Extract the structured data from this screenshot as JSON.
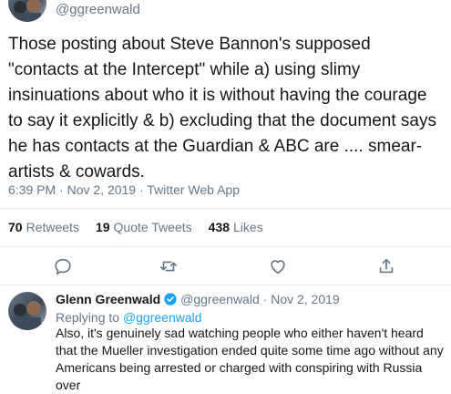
{
  "tweet": {
    "handle": "@ggreenwald",
    "text": "Those posting about Steve Bannon's supposed \"contacts at the Intercept\" while a) using slimy insinuations about who it is without having the courage to say it explicitly & b) excluding that the document says he has contacts at the Guardian & ABC are .... smear-artists & cowards.",
    "time": "6:39 PM",
    "separator": " · ",
    "date": "Nov 2, 2019",
    "app": "Twitter Web App",
    "retweets_count": "70",
    "retweets_label": "Retweets",
    "quote_count": "19",
    "quote_label": "Quote Tweets",
    "likes_count": "438",
    "likes_label": "Likes"
  },
  "actions": {
    "icons": [
      "reply-icon",
      "retweet-icon",
      "like-icon",
      "share-icon"
    ]
  },
  "reply": {
    "name": "Glenn Greenwald",
    "handle": "@ggreenwald",
    "separator": " · ",
    "date": "Nov 2, 2019",
    "replying_prefix": "Replying to ",
    "replying_to": "@ggreenwald",
    "text": "Also, it's genuinely sad watching people who either haven't heard that the Mueller investigation ended quite some time ago without any Americans being arrested or charged with conspiring with Russia over"
  },
  "colors": {
    "text": "#14171a",
    "secondary": "#657786",
    "accent": "#1da1f2",
    "divider": "#e6ecf0"
  }
}
